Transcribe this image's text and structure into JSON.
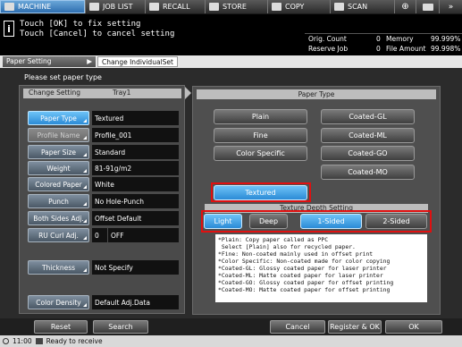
{
  "tabs": [
    {
      "label": "MACHINE",
      "active": true,
      "icon": "machine-icon"
    },
    {
      "label": "JOB LIST",
      "active": false,
      "icon": "job-list-icon"
    },
    {
      "label": "RECALL",
      "active": false,
      "icon": "recall-icon"
    },
    {
      "label": "STORE",
      "active": false,
      "icon": "store-icon"
    },
    {
      "label": "COPY",
      "active": false,
      "icon": "copy-icon"
    },
    {
      "label": "SCAN",
      "active": false,
      "icon": "scan-icon"
    }
  ],
  "message": {
    "line1": "Touch [OK] to fix setting",
    "line2": "Touch [Cancel] to cancel setting"
  },
  "counters": {
    "orig_count_label": "Orig. Count",
    "orig_count_value": "0",
    "memory_label": "Memory",
    "memory_value": "99.999%",
    "reserve_job_label": "Reserve Job",
    "reserve_job_value": "0",
    "file_amount_label": "File Amount",
    "file_amount_value": "99.998%"
  },
  "breadcrumb": {
    "item1": "Paper Setting",
    "item2": "Change IndividualSet"
  },
  "instruction": "Please set paper type",
  "left_panel": {
    "header_left": "Change Setting",
    "header_right": "Tray1",
    "rows": [
      {
        "label": "Paper Type",
        "value": "Textured",
        "selected": true
      },
      {
        "label": "Profile Name",
        "value": "Profile_001",
        "disabled": true
      },
      {
        "label": "Paper Size",
        "value": "Standard"
      },
      {
        "label": "Weight",
        "value": "81-91g/m2"
      },
      {
        "label": "Colored Paper",
        "value": "White"
      },
      {
        "label": "Punch",
        "value": "No Hole-Punch"
      },
      {
        "label": "Both Sides Adj.",
        "value": "Offset Default"
      },
      {
        "label": "RU Curl Adj.",
        "value": "0",
        "value2": "OFF"
      }
    ],
    "thickness": {
      "label": "Thickness",
      "value": "Not Specify"
    },
    "color_density": {
      "label": "Color Density",
      "value": "Default Adj.Data"
    }
  },
  "right_panel": {
    "header": "Paper Type",
    "left_buttons": [
      "Plain",
      "Fine",
      "Color Specific"
    ],
    "right_buttons": [
      "Coated-GL",
      "Coated-ML",
      "Coated-GO",
      "Coated-MO"
    ],
    "textured": "Textured",
    "depth_header": "Texture Depth Setting",
    "depth_buttons": [
      "Light",
      "Deep",
      "1-Sided",
      "2-Sided"
    ],
    "notes": "*Plain: Copy paper called as PPC\n Select [Plain] also for recycled paper.\n*Fine: Non-coated mainly used in offset print\n*Color Specific: Non-coated made for color copying\n*Coated-GL: Glossy coated paper for laser printer\n*Coated-ML: Matte coated paper for laser printer\n*Coated-GO: Glossy coated paper for offset printing\n*Coated-MO: Matte coated paper for offset printing"
  },
  "bottom": {
    "reset": "Reset",
    "search": "Search",
    "cancel": "Cancel",
    "register": "Register & OK",
    "ok": "OK"
  },
  "status": {
    "time": "11:00",
    "text": "Ready to receive"
  },
  "colors": {
    "accent": "#2b8bd6",
    "highlight_border": "#e01010",
    "panel": "#4f4f4f"
  }
}
